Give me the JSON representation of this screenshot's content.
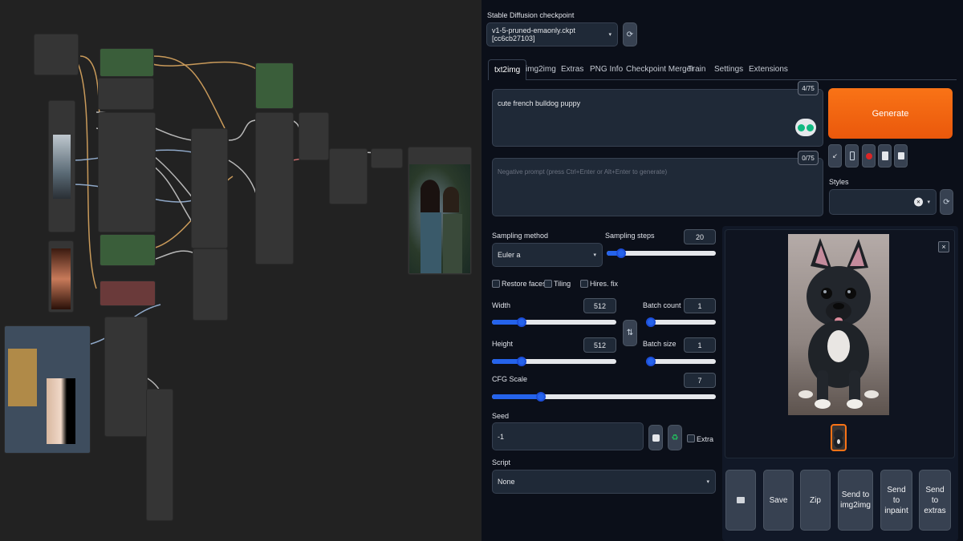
{
  "checkpoint": {
    "label": "Stable Diffusion checkpoint",
    "value": "v1-5-pruned-emaonly.ckpt [cc6cb27103]",
    "refresh_icon": "refresh-icon"
  },
  "tabs": [
    {
      "label": "txt2img",
      "active": true
    },
    {
      "label": "img2img"
    },
    {
      "label": "Extras"
    },
    {
      "label": "PNG Info"
    },
    {
      "label": "Checkpoint Merger"
    },
    {
      "label": "Train"
    },
    {
      "label": "Settings"
    },
    {
      "label": "Extensions"
    }
  ],
  "prompt": {
    "value": "cute french bulldog puppy",
    "token_count": "4/75"
  },
  "negative_prompt": {
    "placeholder": "Negative prompt (press Ctrl+Enter or Alt+Enter to generate)",
    "token_count": "0/75"
  },
  "generate": {
    "label": "Generate"
  },
  "tool_buttons": {
    "read_params": "↙",
    "trash": "🗑",
    "extra_networks": "●",
    "clipboard": "📋",
    "save_style": "💾"
  },
  "styles": {
    "label": "Styles",
    "clear": "×",
    "caret": "▾"
  },
  "sampling": {
    "method_label": "Sampling method",
    "method_value": "Euler a",
    "steps_label": "Sampling steps",
    "steps_value": "20",
    "steps_fraction": 0.13
  },
  "checkboxes": {
    "restore_faces": "Restore faces",
    "tiling": "Tiling",
    "hires_fix": "Hires. fix"
  },
  "width": {
    "label": "Width",
    "value": "512",
    "fraction": 0.24
  },
  "height": {
    "label": "Height",
    "value": "512",
    "fraction": 0.24
  },
  "batch_count": {
    "label": "Batch count",
    "value": "1",
    "fraction": 0.0
  },
  "batch_size": {
    "label": "Batch size",
    "value": "1",
    "fraction": 0.0
  },
  "swap_icon": "⇅",
  "cfg": {
    "label": "CFG Scale",
    "value": "7",
    "fraction": 0.22
  },
  "seed": {
    "label": "Seed",
    "value": "-1",
    "dice_icon": "🎲",
    "recycle_icon": "♻",
    "extra_label": "Extra"
  },
  "script": {
    "label": "Script",
    "value": "None"
  },
  "gallery": {
    "close": "×"
  },
  "output_buttons": {
    "folder": "📁",
    "save": "Save",
    "zip": "Zip",
    "send_img2img": "Send to img2img",
    "send_inpaint": "Send to inpaint",
    "send_extras": "Send to extras"
  },
  "colors": {
    "generate": "#ea580c",
    "accent": "#2563eb",
    "background": "#0b0f19",
    "canvas": "#222222"
  }
}
